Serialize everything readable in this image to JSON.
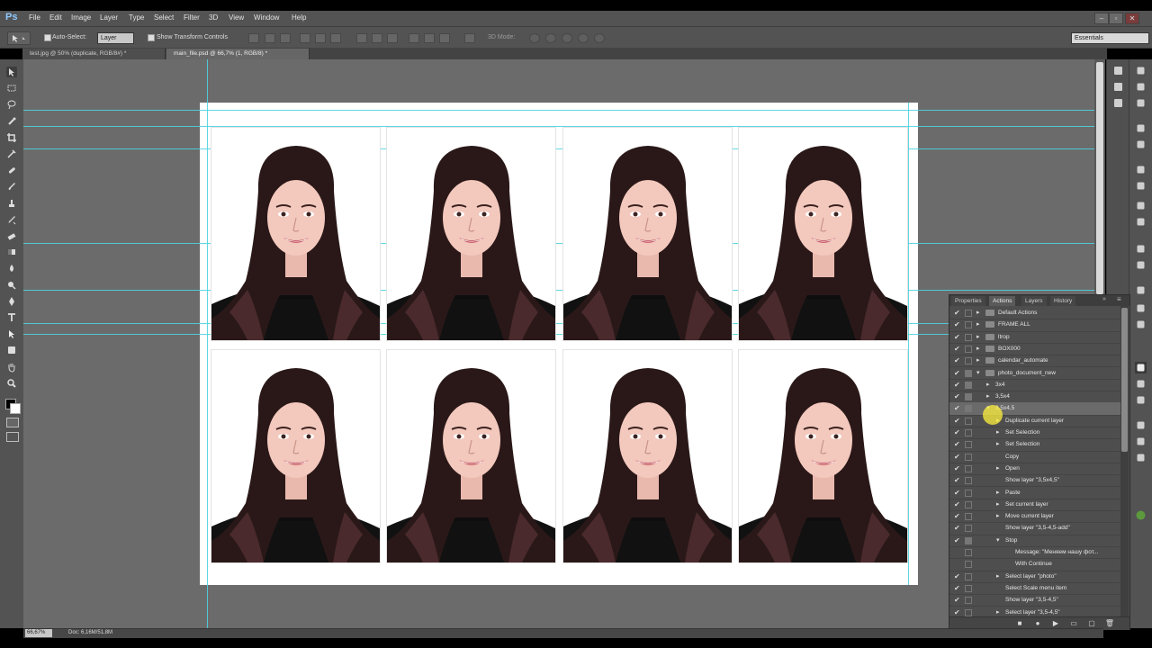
{
  "app": {
    "logo": "Ps"
  },
  "menu": [
    "File",
    "Edit",
    "Image",
    "Layer",
    "Type",
    "Select",
    "Filter",
    "3D",
    "View",
    "Window",
    "Help"
  ],
  "window_controls": {
    "minimize": "–",
    "restore": "▫",
    "close": "✕"
  },
  "options": {
    "auto_select_label": "Auto-Select:",
    "auto_select_value": "Layer",
    "show_transform_label": "Show Transform Controls",
    "mode_3d_label": "3D Mode:",
    "workspace": "Essentials"
  },
  "tabs": [
    {
      "label": "test.jpg @ 50% (duplicate, RGB/8#) *",
      "active": false
    },
    {
      "label": "main_file.psd @ 66,7% (1, RGB/8) *",
      "active": true
    }
  ],
  "panel": {
    "tabs": [
      "Properties",
      "Actions",
      "Layers",
      "History"
    ],
    "active_tab": "Actions",
    "rows": [
      {
        "check": "✔",
        "dialog": false,
        "indent": 0,
        "expanded": false,
        "folder": true,
        "label": "Default Actions",
        "selected": false
      },
      {
        "check": "✔",
        "dialog": false,
        "indent": 0,
        "expanded": false,
        "folder": true,
        "label": "FRAME ALL",
        "selected": false
      },
      {
        "check": "✔",
        "dialog": false,
        "indent": 0,
        "expanded": false,
        "folder": true,
        "label": "ltrop",
        "selected": false
      },
      {
        "check": "✔",
        "dialog": false,
        "indent": 0,
        "expanded": false,
        "folder": true,
        "label": "BOX000",
        "selected": false
      },
      {
        "check": "✔",
        "dialog": false,
        "indent": 0,
        "expanded": false,
        "folder": true,
        "label": "calendar_automate",
        "selected": false
      },
      {
        "check": "✔",
        "dialog": true,
        "indent": 0,
        "expanded": true,
        "folder": true,
        "label": "photo_document_new",
        "selected": false
      },
      {
        "check": "✔",
        "dialog": true,
        "indent": 1,
        "expanded": false,
        "folder": false,
        "label": "3x4",
        "selected": false
      },
      {
        "check": "✔",
        "dialog": true,
        "indent": 1,
        "expanded": false,
        "folder": false,
        "label": "3,5x4",
        "selected": false
      },
      {
        "check": "✔",
        "dialog": true,
        "indent": 1,
        "expanded": true,
        "folder": false,
        "label": "3,5x4,5",
        "selected": true
      },
      {
        "check": "✔",
        "dialog": false,
        "indent": 2,
        "expanded": false,
        "folder": false,
        "label": "Duplicate current layer",
        "selected": false
      },
      {
        "check": "✔",
        "dialog": false,
        "indent": 2,
        "expanded": false,
        "folder": false,
        "label": "Set Selection",
        "selected": false
      },
      {
        "check": "✔",
        "dialog": false,
        "indent": 2,
        "expanded": false,
        "folder": false,
        "label": "Set Selection",
        "selected": false
      },
      {
        "check": "✔",
        "dialog": false,
        "indent": 2,
        "expanded": null,
        "folder": false,
        "label": "Copy",
        "selected": false
      },
      {
        "check": "✔",
        "dialog": false,
        "indent": 2,
        "expanded": false,
        "folder": false,
        "label": "Open",
        "selected": false
      },
      {
        "check": "✔",
        "dialog": false,
        "indent": 2,
        "expanded": null,
        "folder": false,
        "label": "Show layer \"3,5x4,5\"",
        "selected": false
      },
      {
        "check": "✔",
        "dialog": false,
        "indent": 2,
        "expanded": false,
        "folder": false,
        "label": "Paste",
        "selected": false
      },
      {
        "check": "✔",
        "dialog": false,
        "indent": 2,
        "expanded": false,
        "folder": false,
        "label": "Set current layer",
        "selected": false
      },
      {
        "check": "✔",
        "dialog": false,
        "indent": 2,
        "expanded": false,
        "folder": false,
        "label": "Move current layer",
        "selected": false
      },
      {
        "check": "✔",
        "dialog": false,
        "indent": 2,
        "expanded": null,
        "folder": false,
        "label": "Show layer \"3,5-4,5-add\"",
        "selected": false
      },
      {
        "check": "✔",
        "dialog": true,
        "indent": 2,
        "expanded": true,
        "folder": false,
        "label": "Stop",
        "selected": false
      },
      {
        "check": "",
        "dialog": false,
        "indent": 3,
        "expanded": null,
        "folder": false,
        "label": "Message: \"Меняем нашу фот...",
        "selected": false
      },
      {
        "check": "",
        "dialog": false,
        "indent": 3,
        "expanded": null,
        "folder": false,
        "label": "With Continue",
        "selected": false
      },
      {
        "check": "✔",
        "dialog": false,
        "indent": 2,
        "expanded": false,
        "folder": false,
        "label": "Select layer \"photo\"",
        "selected": false
      },
      {
        "check": "✔",
        "dialog": false,
        "indent": 2,
        "expanded": null,
        "folder": false,
        "label": "Select Scale menu item",
        "selected": false
      },
      {
        "check": "✔",
        "dialog": false,
        "indent": 2,
        "expanded": null,
        "folder": false,
        "label": "Show layer \"3,5-4,5\"",
        "selected": false
      },
      {
        "check": "✔",
        "dialog": false,
        "indent": 2,
        "expanded": false,
        "folder": false,
        "label": "Select layer \"3,5-4,5\"",
        "selected": false
      }
    ]
  },
  "status": {
    "zoom": "66,67%",
    "doc": "Doc: 6,16M/51,8M"
  },
  "colors": {
    "guide": "#4fd3e0",
    "canvas_bg": "#6b6b6b",
    "panel_bg": "#4e4e4e",
    "selection_highlight": "#6a6a6a"
  }
}
